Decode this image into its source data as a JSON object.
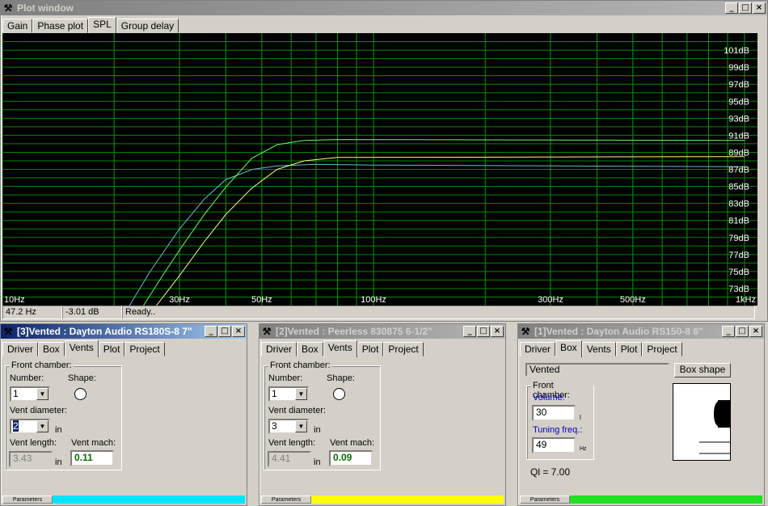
{
  "plot_window": {
    "title": "Plot window",
    "tabs": [
      "Gain",
      "Phase plot",
      "SPL",
      "Group delay"
    ],
    "selected_tab": "SPL",
    "status": {
      "freq": "47.2 Hz",
      "db": "-3.01 dB",
      "msg": "Ready.."
    }
  },
  "chart_data": {
    "type": "line",
    "x_scale": "log",
    "xlim": [
      10,
      1000
    ],
    "ylim": [
      71,
      103
    ],
    "x_tick_labels": [
      {
        "v": 10,
        "label": "10Hz"
      },
      {
        "v": 30,
        "label": "30Hz"
      },
      {
        "v": 50,
        "label": "50Hz"
      },
      {
        "v": 100,
        "label": "100Hz"
      },
      {
        "v": 300,
        "label": "300Hz"
      },
      {
        "v": 500,
        "label": "500Hz"
      },
      {
        "v": 1000,
        "label": "1kHz"
      }
    ],
    "y_tick_labels": [
      {
        "v": 101,
        "label": "101dB"
      },
      {
        "v": 99,
        "label": "99dB"
      },
      {
        "v": 97,
        "label": "97dB"
      },
      {
        "v": 95,
        "label": "95dB"
      },
      {
        "v": 93,
        "label": "93dB"
      },
      {
        "v": 91,
        "label": "91dB"
      },
      {
        "v": 89,
        "label": "89dB"
      },
      {
        "v": 87,
        "label": "87dB"
      },
      {
        "v": 85,
        "label": "85dB"
      },
      {
        "v": 83,
        "label": "83dB"
      },
      {
        "v": 81,
        "label": "81dB"
      },
      {
        "v": 79,
        "label": "79dB"
      },
      {
        "v": 77,
        "label": "77dB"
      },
      {
        "v": 75,
        "label": "75dB"
      },
      {
        "v": 73,
        "label": "73dB"
      }
    ],
    "series": [
      {
        "color": "#60c0d0",
        "x": [
          22,
          25,
          30,
          35,
          40,
          47.2,
          55,
          70,
          100,
          1000
        ],
        "y": [
          71,
          75,
          80,
          83.5,
          85.8,
          87.0,
          87.4,
          87.6,
          87.5,
          87.3
        ]
      },
      {
        "color": "#60ff60",
        "x": [
          24,
          27,
          30,
          35,
          40,
          47,
          55,
          65,
          80,
          1000
        ],
        "y": [
          71,
          74.5,
          77.5,
          81.7,
          84.9,
          88.3,
          89.9,
          90.4,
          90.5,
          90.4
        ]
      },
      {
        "color": "#ffff80",
        "x": [
          26,
          30,
          35,
          40,
          47,
          55,
          65,
          80,
          1000
        ],
        "y": [
          71,
          74.5,
          78.5,
          81.7,
          84.8,
          87.0,
          88.0,
          88.4,
          88.5
        ]
      }
    ]
  },
  "windows": [
    {
      "title": "[3]Vented : Dayton Audio RS180S-8 7\"",
      "active": true,
      "tabs": [
        "Driver",
        "Box",
        "Vents",
        "Plot",
        "Project"
      ],
      "selected_tab": "Vents",
      "front_chamber": "Front chamber:",
      "number_label": "Number:",
      "number_value": "1",
      "shape_label": "Shape:",
      "vent_diameter_label": "Vent diameter:",
      "vent_diameter_value": "2",
      "unit_in": "in",
      "vent_length_label": "Vent length:",
      "vent_length_value": "3.43",
      "vent_mach_label": "Vent mach:",
      "vent_mach_value": "0.11",
      "params_label": "Parameters",
      "color": "#00e5ff"
    },
    {
      "title": "[2]Vented : Peerless 830875 6-1/2\"",
      "active": false,
      "tabs": [
        "Driver",
        "Box",
        "Vents",
        "Plot",
        "Project"
      ],
      "selected_tab": "Vents",
      "front_chamber": "Front chamber:",
      "number_label": "Number:",
      "number_value": "1",
      "shape_label": "Shape:",
      "vent_diameter_label": "Vent diameter:",
      "vent_diameter_value": "3",
      "unit_in": "in",
      "vent_length_label": "Vent length:",
      "vent_length_value": "4.41",
      "vent_mach_label": "Vent mach:",
      "vent_mach_value": "0.09",
      "params_label": "Parameters",
      "color": "#ffff00"
    },
    {
      "title": "[1]Vented : Dayton Audio RS150-8 6\"",
      "active": false,
      "tabs": [
        "Driver",
        "Box",
        "Vents",
        "Plot",
        "Project"
      ],
      "selected_tab": "Box",
      "box_type": "Vented",
      "box_shape_button": "Box shape",
      "front_chamber": "Front chamber:",
      "volume_label": "Volume:",
      "volume_value": "30",
      "volume_unit": "l",
      "tuning_label": "Tuning freq.:",
      "tuning_value": "49",
      "tuning_unit": "Hz",
      "ql": "Ql = 7.00",
      "params_label": "Parameters",
      "color": "#20e020"
    }
  ]
}
